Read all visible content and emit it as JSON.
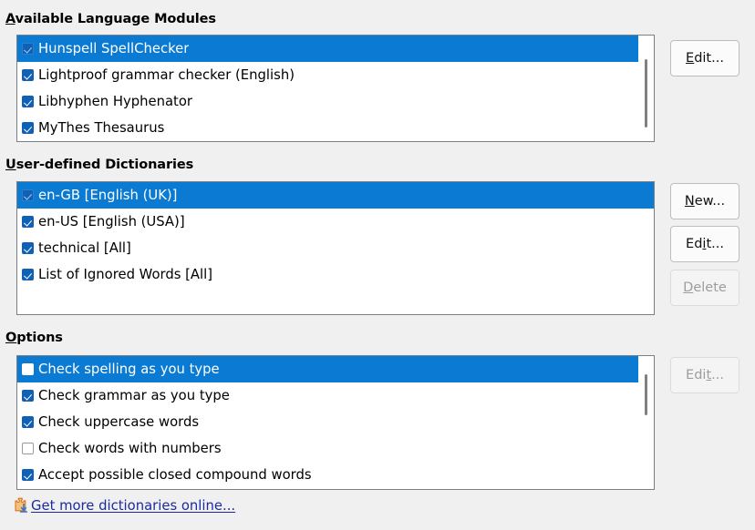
{
  "sections": {
    "modules": {
      "heading_accel": "A",
      "heading_rest": "vailable Language Modules",
      "items": [
        {
          "label": "Hunspell SpellChecker",
          "checked": true,
          "selected": true
        },
        {
          "label": "Lightproof grammar checker (English)",
          "checked": true,
          "selected": false
        },
        {
          "label": "Libhyphen Hyphenator",
          "checked": true,
          "selected": false
        },
        {
          "label": "MyThes Thesaurus",
          "checked": true,
          "selected": false
        }
      ],
      "edit_button": {
        "accel": "E",
        "rest": "dit...",
        "disabled": false
      }
    },
    "dictionaries": {
      "heading_accel": "U",
      "heading_rest": "ser-defined Dictionaries",
      "items": [
        {
          "label": "en-GB [English (UK)]",
          "checked": true,
          "selected": true
        },
        {
          "label": "en-US [English (USA)]",
          "checked": true,
          "selected": false
        },
        {
          "label": "technical [All]",
          "checked": true,
          "selected": false
        },
        {
          "label": "List of Ignored Words [All]",
          "checked": true,
          "selected": false
        }
      ],
      "new_button": {
        "pre": "",
        "accel": "N",
        "rest": "ew...",
        "disabled": false
      },
      "edit_button": {
        "pre": "Ed",
        "accel": "i",
        "rest": "t...",
        "disabled": false
      },
      "delete_button": {
        "pre": "",
        "accel": "D",
        "rest": "elete",
        "disabled": true
      }
    },
    "options": {
      "heading_accel": "O",
      "heading_rest": "ptions",
      "items": [
        {
          "label": "Check spelling as you type",
          "checked": false,
          "selected": true
        },
        {
          "label": "Check grammar as you type",
          "checked": true,
          "selected": false
        },
        {
          "label": "Check uppercase words",
          "checked": true,
          "selected": false
        },
        {
          "label": "Check words with numbers",
          "checked": false,
          "selected": false
        },
        {
          "label": "Accept possible closed compound words",
          "checked": true,
          "selected": false
        }
      ],
      "edit_button": {
        "pre": "Edi",
        "accel": "t",
        "rest": "...",
        "disabled": true
      }
    }
  },
  "footer": {
    "link_label": "Get more dictionaries online...",
    "icon": "extension-download-icon"
  },
  "colors": {
    "selection_blue": "#0a7ad2",
    "checkbox_blue": "#1060b5",
    "link_blue": "#1a2b9e",
    "background": "#f0f0f0"
  }
}
